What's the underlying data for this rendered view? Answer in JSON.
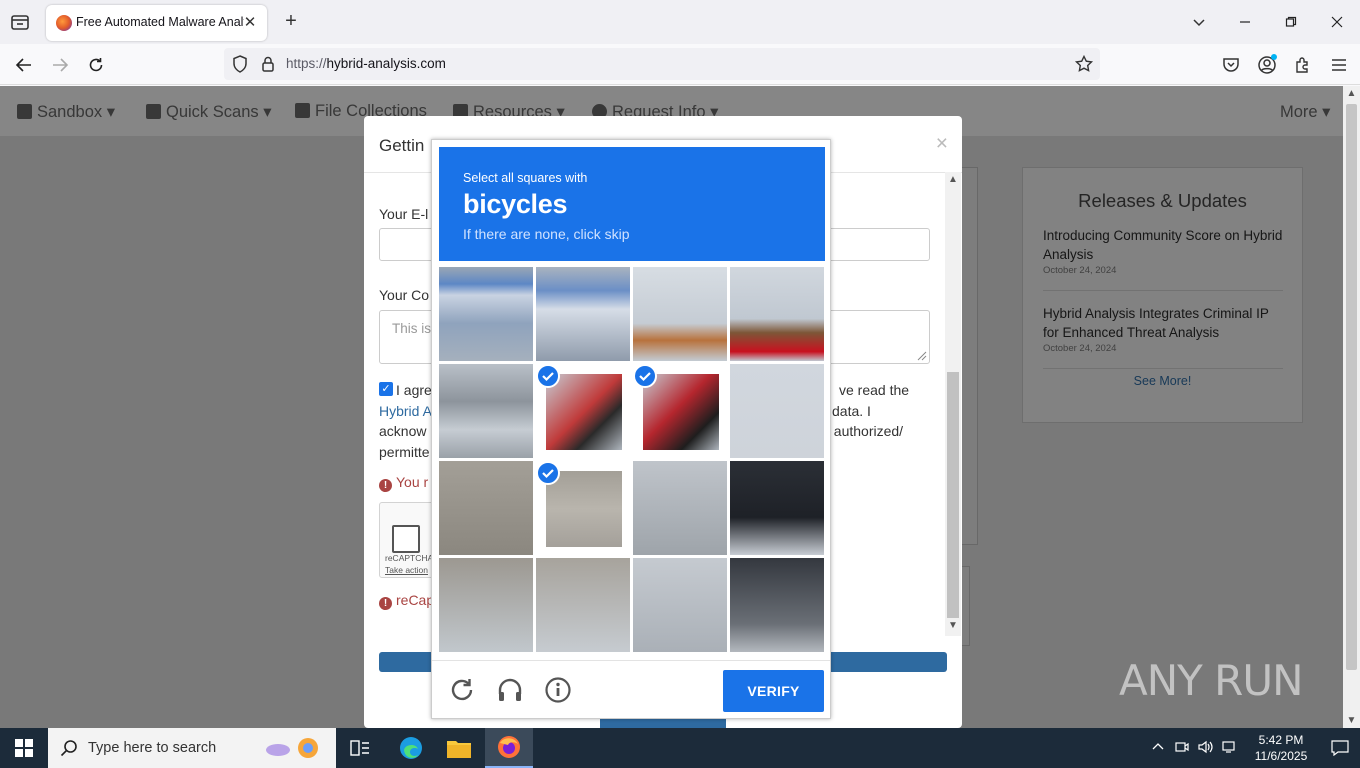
{
  "browser": {
    "tab_title": "Free Automated Malware Analysis",
    "url_scheme": "https://",
    "url_host": "hybrid-analysis.com"
  },
  "site_nav": {
    "items": [
      "Sandbox ▾",
      "Quick Scans ▾",
      "File Collections",
      "Resources ▾",
      "Request Info ▾"
    ],
    "more": "More ▾"
  },
  "releases": {
    "title": "Releases & Updates",
    "items": [
      {
        "title": "Introducing Community Score on Hybrid Analysis",
        "date": "October 24, 2024"
      },
      {
        "title": "Hybrid Analysis Integrates Criminal IP for Enhanced Threat Analysis",
        "date": "October 24, 2024"
      }
    ],
    "see_more": "See More!"
  },
  "modal": {
    "title": "Gettin",
    "close": "×",
    "email_label": "Your E-l",
    "comment_label": "Your Co",
    "comment_placeholder": "This is",
    "agree_line1": "I agre",
    "agree_line1_right": "ve read the",
    "agree_line2_link": "Hybrid A",
    "agree_line2_right": "data. I",
    "agree_line3": "acknow",
    "agree_line3_right": "t authorized/",
    "agree_line4": "permitte",
    "error1": "You r",
    "error2": "reCap",
    "recaptcha_label": "reCAPTCHA",
    "recaptcha_action": "Take action"
  },
  "challenge": {
    "line1": "Select all squares with",
    "target": "bicycles",
    "line3": "If there are none, click skip",
    "verify_label": "VERIFY",
    "selected_tiles": [
      5,
      6,
      9
    ],
    "icons": [
      "reload-icon",
      "audio-icon",
      "info-icon"
    ]
  },
  "watermark": "ANY RUN",
  "taskbar": {
    "search_placeholder": "Type here to search",
    "time": "5:42 PM",
    "date": "11/6/2025"
  },
  "colors": {
    "challenge_blue": "#1a73e8",
    "link_blue": "#2e6aa0",
    "error_red": "#a94442",
    "taskbar": "#1c2b3a"
  }
}
